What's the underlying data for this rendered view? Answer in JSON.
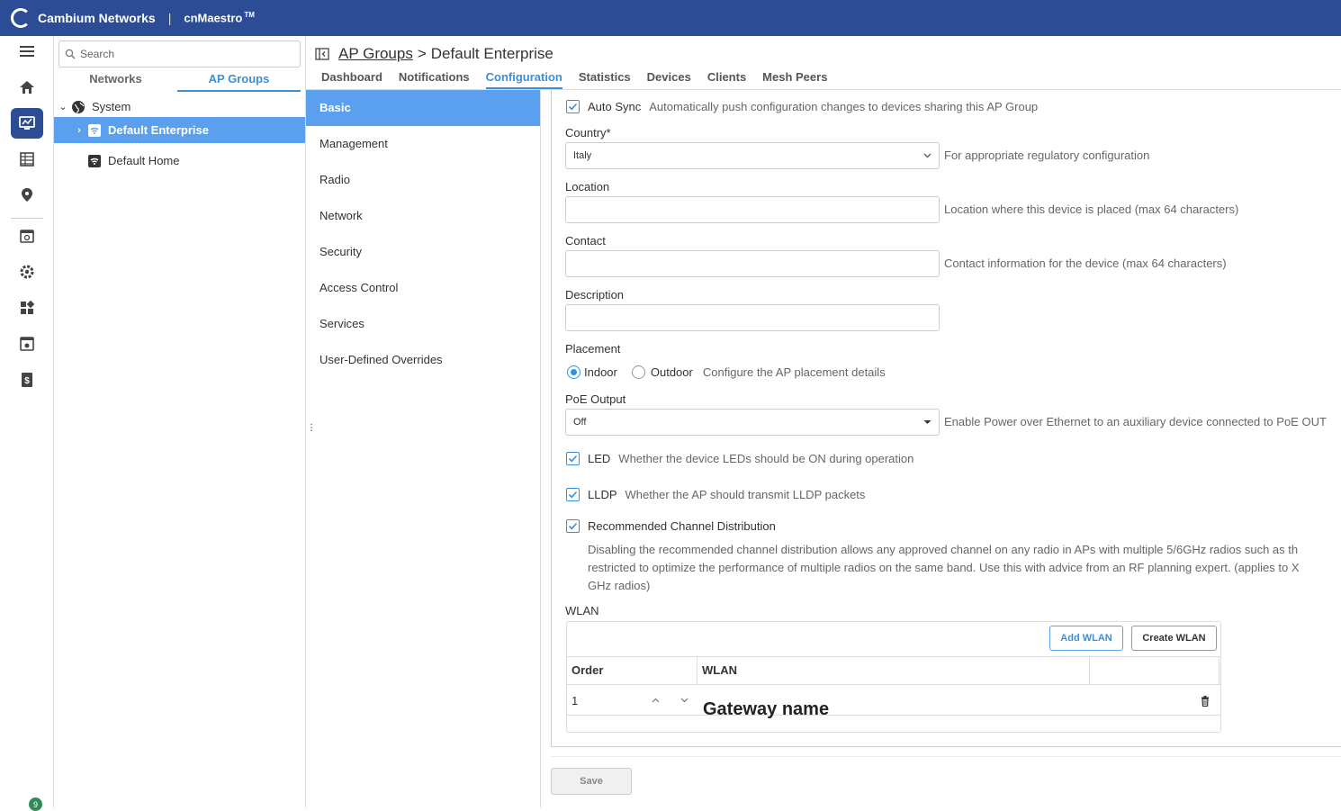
{
  "header": {
    "brand": "Cambium Networks",
    "separator": "|",
    "product_prefix": "cn",
    "product_name": "Maestro",
    "trademark": "TM"
  },
  "rail": {
    "badge_count": "9"
  },
  "tree": {
    "search_placeholder": "Search",
    "tabs": [
      "Networks",
      "AP Groups"
    ],
    "nodes": {
      "system": "System",
      "default_enterprise": "Default Enterprise",
      "default_home": "Default Home"
    }
  },
  "breadcrumb": {
    "parent": "AP Groups",
    "separator": ">",
    "current": "Default Enterprise"
  },
  "main_tabs": [
    "Dashboard",
    "Notifications",
    "Configuration",
    "Statistics",
    "Devices",
    "Clients",
    "Mesh Peers"
  ],
  "subnav": [
    "Basic",
    "Management",
    "Radio",
    "Network",
    "Security",
    "Access Control",
    "Services",
    "User-Defined Overrides"
  ],
  "form": {
    "auto_sync": {
      "label": "Auto Sync",
      "hint": "Automatically push configuration changes to devices sharing this AP Group",
      "checked": true
    },
    "country": {
      "label": "Country*",
      "value": "Italy",
      "hint": "For appropriate regulatory configuration"
    },
    "location": {
      "label": "Location",
      "value": "",
      "hint": "Location where this device is placed (max 64 characters)"
    },
    "contact": {
      "label": "Contact",
      "value": "",
      "hint": "Contact information for the device (max 64 characters)"
    },
    "description": {
      "label": "Description",
      "value": ""
    },
    "placement": {
      "label": "Placement",
      "options": [
        "Indoor",
        "Outdoor"
      ],
      "selected": "Indoor",
      "hint": "Configure the AP placement details"
    },
    "poe": {
      "label": "PoE Output",
      "value": "Off",
      "hint": "Enable Power over Ethernet to an auxiliary device connected to PoE OUT"
    },
    "led": {
      "label": "LED",
      "hint": "Whether the device LEDs should be ON during operation",
      "checked": true
    },
    "lldp": {
      "label": "LLDP",
      "hint": "Whether the AP should transmit LLDP packets",
      "checked": true
    },
    "rcd": {
      "label": "Recommended Channel Distribution",
      "checked": true,
      "description_line1": "Disabling the recommended channel distribution allows any approved channel on any radio in APs with multiple 5/6GHz radios such as th",
      "description_line2": "restricted to optimize the performance of multiple radios on the same band. Use this with advice from an RF planning expert. (applies to X",
      "description_line3": "GHz radios)"
    },
    "wlan": {
      "label": "WLAN",
      "add_button": "Add WLAN",
      "create_button": "Create WLAN",
      "columns": [
        "Order",
        "WLAN",
        ""
      ],
      "rows": [
        {
          "order": "1",
          "wlan": "Gateway name"
        }
      ]
    }
  },
  "footer": {
    "save_label": "Save"
  },
  "colors": {
    "topbar": "#2c4c96",
    "accent": "#3a8fd9",
    "selected_bg": "#5aa0ef"
  }
}
